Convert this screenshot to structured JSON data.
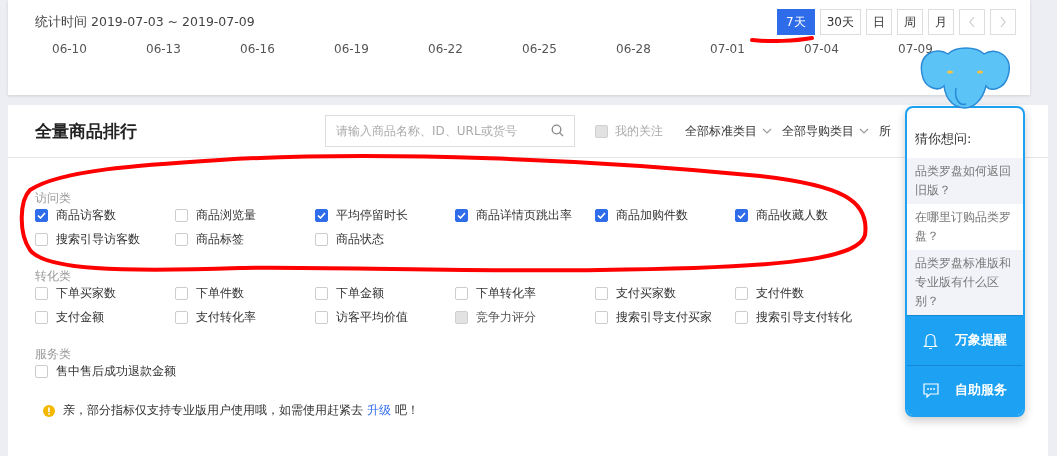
{
  "stats_header": {
    "period_label": "统计时间 2019-07-03 ~ 2019-07-09",
    "range_buttons": [
      {
        "label": "7天",
        "selected": true
      },
      {
        "label": "30天",
        "selected": false
      },
      {
        "label": "日",
        "selected": false
      },
      {
        "label": "周",
        "selected": false
      },
      {
        "label": "月",
        "selected": false
      }
    ]
  },
  "chart_axis": {
    "labels": [
      "06-10",
      "06-13",
      "06-16",
      "06-19",
      "06-22",
      "06-25",
      "06-28",
      "07-01",
      "07-04",
      "07-09"
    ]
  },
  "ranking": {
    "title": "全量商品排行",
    "search": {
      "placeholder": "请输入商品名称、ID、URL或货号"
    },
    "follow_filter": {
      "label": "我的关注",
      "checked": false,
      "disabled": true
    },
    "dropdowns": [
      "全部标准类目",
      "全部导购类目",
      "所"
    ],
    "groups": [
      {
        "title": "访问类",
        "items": [
          {
            "label": "商品访客数",
            "checked": true,
            "disabled": false
          },
          {
            "label": "商品浏览量",
            "checked": false,
            "disabled": false
          },
          {
            "label": "平均停留时长",
            "checked": true,
            "disabled": false
          },
          {
            "label": "商品详情页跳出率",
            "checked": true,
            "disabled": false
          },
          {
            "label": "商品加购件数",
            "checked": true,
            "disabled": false
          },
          {
            "label": "商品收藏人数",
            "checked": true,
            "disabled": false
          },
          {
            "label": "搜索引导访客数",
            "checked": false,
            "disabled": false
          },
          {
            "label": "商品标签",
            "checked": false,
            "disabled": false
          },
          {
            "label": "商品状态",
            "checked": false,
            "disabled": false
          }
        ]
      },
      {
        "title": "转化类",
        "items": [
          {
            "label": "下单买家数",
            "checked": false,
            "disabled": false
          },
          {
            "label": "下单件数",
            "checked": false,
            "disabled": false
          },
          {
            "label": "下单金额",
            "checked": false,
            "disabled": false
          },
          {
            "label": "下单转化率",
            "checked": false,
            "disabled": false
          },
          {
            "label": "支付买家数",
            "checked": false,
            "disabled": false
          },
          {
            "label": "支付件数",
            "checked": false,
            "disabled": false
          },
          {
            "label": "支付金额",
            "checked": false,
            "disabled": false
          },
          {
            "label": "支付转化率",
            "checked": false,
            "disabled": false
          },
          {
            "label": "访客平均价值",
            "checked": false,
            "disabled": false
          },
          {
            "label": "竞争力评分",
            "checked": false,
            "disabled": true
          },
          {
            "label": "搜索引导支付买家",
            "checked": false,
            "disabled": false
          },
          {
            "label": "搜索引导支付转化",
            "checked": false,
            "disabled": false
          }
        ]
      },
      {
        "title": "服务类",
        "items": [
          {
            "label": "售中售后成功退款金额",
            "checked": false,
            "disabled": false
          }
        ]
      }
    ],
    "notice": {
      "text_before": "亲，部分指标仅支持专业版用户使用哦，如需使用赶紧去 ",
      "link": "升级",
      "text_after": " 吧！"
    }
  },
  "help_widget": {
    "title": "猜你想问:",
    "questions": [
      "品类罗盘如何返回旧版？",
      "在哪里订购品类罗盘？",
      "品类罗盘标准版和专业版有什么区别？"
    ],
    "actions": [
      {
        "kind": "bell",
        "label": "万象提醒"
      },
      {
        "kind": "chat",
        "label": "自助服务"
      }
    ]
  }
}
